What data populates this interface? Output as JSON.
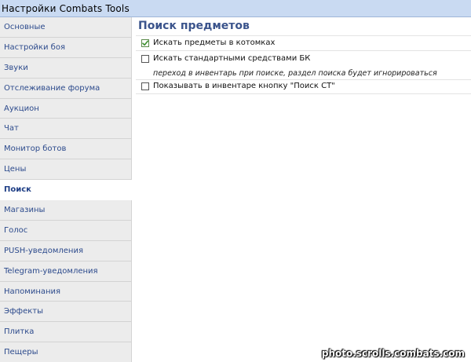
{
  "window": {
    "title": "Настройки Combats Tools"
  },
  "sidebar": {
    "items": [
      {
        "label": "Основные"
      },
      {
        "label": "Настройки боя"
      },
      {
        "label": "Звуки"
      },
      {
        "label": "Отслеживание форума"
      },
      {
        "label": "Аукцион"
      },
      {
        "label": "Чат"
      },
      {
        "label": "Монитор ботов"
      },
      {
        "label": "Цены"
      },
      {
        "label": "Поиск",
        "active": true
      },
      {
        "label": "Магазины"
      },
      {
        "label": "Голос"
      },
      {
        "label": "PUSH-уведомления"
      },
      {
        "label": "Telegram-уведомления"
      },
      {
        "label": "Напоминания"
      },
      {
        "label": "Эффекты"
      },
      {
        "label": "Плитка"
      },
      {
        "label": "Пещеры"
      }
    ]
  },
  "main": {
    "title": "Поиск предметов",
    "options": [
      {
        "label": "Искать предметы в котомках",
        "checked": true
      },
      {
        "label": "Искать стандартными средствами БК",
        "checked": false,
        "note": "переход в инвентарь при поиске, раздел поиска будет игнорироваться"
      },
      {
        "label": "Показывать в инвентаре кнопку \"Поиск СТ\"",
        "checked": false
      }
    ]
  },
  "watermark": "photo.scrolls.combats.com",
  "colors": {
    "titlebar": "#c9daf2",
    "sidebar_bg": "#ececec",
    "link": "#2c4a8c",
    "heading": "#3b548c",
    "check": "#3c8f2e"
  }
}
